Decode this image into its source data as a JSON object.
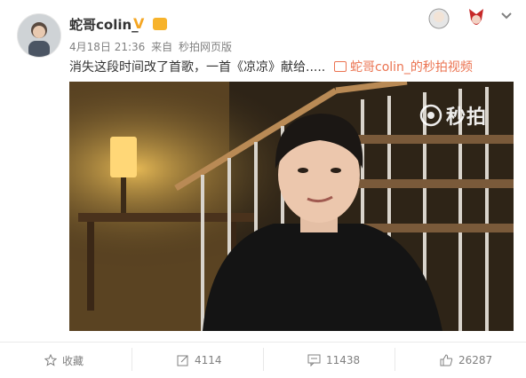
{
  "post": {
    "author": "蛇哥colin_",
    "verified_badge": "V",
    "date": "4月18日 21:36",
    "source_prefix": "来自",
    "source": "秒拍网页版",
    "text": "消失这段时间改了首歌，一首《凉凉》献给.....",
    "video_link": "蛇哥colin_的秒拍视频",
    "video_watermark": "秒拍"
  },
  "actions": {
    "favorite": "收藏",
    "repost_count": "4114",
    "comment_count": "11438",
    "like_count": "26287"
  },
  "colors": {
    "link": "#eb7350",
    "text": "#333333",
    "meta": "#808080",
    "badge": "#f5a623"
  },
  "icons": [
    "star-icon",
    "repost-icon",
    "comment-icon",
    "like-icon",
    "video-icon",
    "chevron-down-icon",
    "miaopai-logo-icon"
  ]
}
